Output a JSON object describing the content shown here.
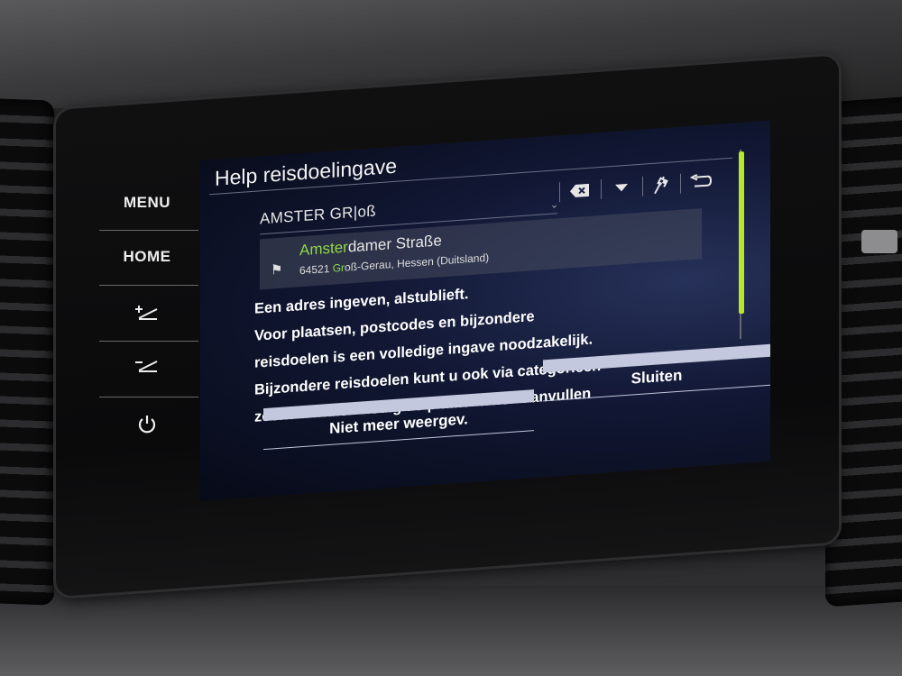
{
  "side_buttons": {
    "menu": "MENU",
    "home": "HOME",
    "volume_up_icon": "volume-up-icon",
    "volume_down_icon": "volume-down-icon",
    "power_icon": "power-icon"
  },
  "screen": {
    "title": "Help reisdoelingave",
    "input": {
      "value": "AMSTER GR|oß"
    },
    "toolbar": {
      "icons": [
        "backspace-icon",
        "chevron-down-icon",
        "destination-flag-icon",
        "back-icon"
      ]
    },
    "suggestion": {
      "name_highlight": "Amster",
      "name_rest": "damer Straße",
      "addr_prefix": "64521 ",
      "addr_highlight": "Gr",
      "addr_rest": "oß-Gerau, Hessen (Duitsland)"
    },
    "help_lines": [
      "Een adres ingeven, alstublieft.",
      "Voor plaatsen, postcodes en bijzondere",
      "reisdoelen is een volledige ingave noodzakelijk.",
      "Bijzondere reisdoelen kunt u ook via categorieën",
      "zoeken. Indien nodig de plaatsnamen aanvullen"
    ],
    "buttons": {
      "dont_show": "Niet meer weergev.",
      "close": "Sluiten"
    },
    "accent_color": "#8ed84a",
    "scroll_color": "#b8e62a"
  }
}
